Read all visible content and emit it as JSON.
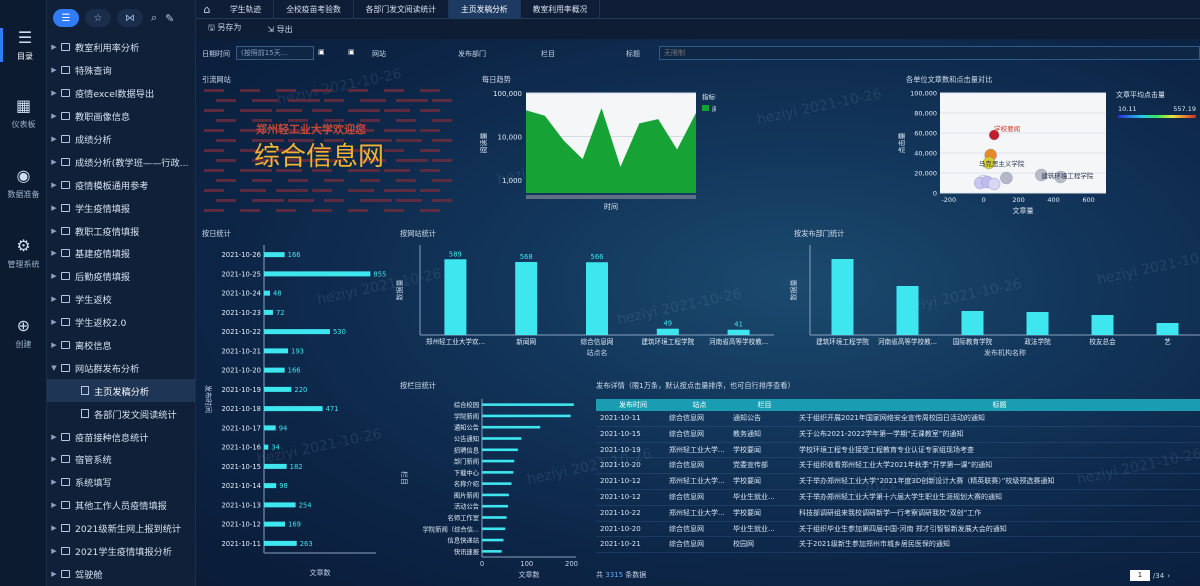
{
  "rail": [
    {
      "label": "目录",
      "icon": "list-icon"
    },
    {
      "label": "仪表板",
      "icon": "dashboard-icon"
    },
    {
      "label": "数据准备",
      "icon": "database-icon"
    },
    {
      "label": "管理系统",
      "icon": "gear-icon"
    },
    {
      "label": "创建",
      "icon": "plus-icon"
    }
  ],
  "tree": [
    {
      "label": "教室利用率分析",
      "child": false
    },
    {
      "label": "特殊查询",
      "child": false
    },
    {
      "label": "疫情excel数据导出",
      "child": false
    },
    {
      "label": "教职画像信息",
      "child": false
    },
    {
      "label": "成绩分析",
      "child": false
    },
    {
      "label": "成绩分析(教学班——行政...",
      "child": false
    },
    {
      "label": "疫情模板通用参考",
      "child": false
    },
    {
      "label": "学生疫情填报",
      "child": false
    },
    {
      "label": "教职工疫情填报",
      "child": false
    },
    {
      "label": "基建疫情填报",
      "child": false
    },
    {
      "label": "后勤疫情填报",
      "child": false
    },
    {
      "label": "学生返校",
      "child": false
    },
    {
      "label": "学生返校2.0",
      "child": false
    },
    {
      "label": "离校信息",
      "child": false
    },
    {
      "label": "网站群发布分析",
      "child": false,
      "open": true
    },
    {
      "label": "主页发稿分析",
      "child": true,
      "sel": true
    },
    {
      "label": "各部门发文阅读统计",
      "child": true
    },
    {
      "label": "疫苗接种信息统计",
      "child": false
    },
    {
      "label": "宿管系统",
      "child": false
    },
    {
      "label": "系统填写",
      "child": false
    },
    {
      "label": "其他工作人员疫情填报",
      "child": false
    },
    {
      "label": "2021级新生网上报到统计",
      "child": false
    },
    {
      "label": "2021学生疫情填报分析",
      "child": false
    },
    {
      "label": "驾驶舱",
      "child": false
    }
  ],
  "tabs": [
    "学生轨迹",
    "全校疫苗考验数",
    "各部门发文阅读统计",
    "主页发稿分析",
    "教室利用率概况"
  ],
  "active_tab": 3,
  "toolbar": {
    "save": "另存为",
    "export": "导出"
  },
  "filters": {
    "date_label": "日期时间",
    "date_value": "(按照前15天...",
    "site_label": "网站",
    "dept_label": "发布部门",
    "column_label": "栏目",
    "title_label": "标题",
    "title_placeholder": "无限制"
  },
  "wordcloud": {
    "title": "引流网站",
    "main": "综合信息网",
    "sub": "郑州轻工业大学欢迎您"
  },
  "trend": {
    "title": "每日趋势",
    "ylabel": "阅读量",
    "xlabel": "时间",
    "legend_title": "指标名称",
    "legend_item": "阅读量",
    "yticks": [
      "100,000",
      "10,000",
      "1,000"
    ]
  },
  "scatter": {
    "title": "各单位文章数和点击量对比",
    "xlabel": "文章量",
    "ylabel": "点击量",
    "colorbar_title": "文章平均点击量",
    "cb_min": "10.11",
    "cb_max": "557.19",
    "labels": [
      "学校要闻",
      "马克思主义学院",
      "建筑环境工程学院"
    ],
    "xticks": [
      "-200",
      "0",
      "200",
      "400",
      "600"
    ],
    "yticks": [
      "100,000",
      "80,000",
      "60,000",
      "40,000",
      "20,000",
      "0"
    ]
  },
  "colors": {
    "accent": "#2f7cf6",
    "bar": "#3ee6f0",
    "area": "#16a235",
    "header": "#1a9db2"
  },
  "chart_data": [
    {
      "type": "bar",
      "orientation": "horizontal",
      "title": "按日统计",
      "xlabel": "文章数",
      "ylabel": "发布时间",
      "categories": [
        "2021-10-26",
        "2021-10-25",
        "2021-10-24",
        "2021-10-23",
        "2021-10-22",
        "2021-10-21",
        "2021-10-20",
        "2021-10-19",
        "2021-10-18",
        "2021-10-17",
        "2021-10-16",
        "2021-10-15",
        "2021-10-14",
        "2021-10-13",
        "2021-10-12",
        "2021-10-11"
      ],
      "values": [
        166,
        855,
        48,
        72,
        530,
        193,
        166,
        220,
        471,
        94,
        34,
        182,
        98,
        254,
        169,
        263
      ],
      "xlim": [
        0,
        900
      ]
    },
    {
      "type": "bar",
      "title": "按网站统计",
      "xlabel": "站点名",
      "ylabel": "数据量",
      "categories": [
        "郑州轻工业大学欢...",
        "新闻网",
        "综合信息网",
        "建筑环境工程学院",
        "河南省高等学校教..."
      ],
      "values": [
        589,
        568,
        566,
        49,
        41
      ],
      "ylim": [
        0,
        700
      ]
    },
    {
      "type": "bar",
      "title": "按发布部门统计",
      "xlabel": "发布机构名称",
      "ylabel": "数据量",
      "categories": [
        "建筑环境工程学院",
        "河南省高等学校教...",
        "国际教育学院",
        "政法学院",
        "校友总会",
        "艺"
      ],
      "values": [
        380,
        245,
        120,
        115,
        100,
        60
      ],
      "ylim": [
        0,
        450
      ]
    },
    {
      "type": "bar",
      "orientation": "horizontal",
      "title": "按栏目统计",
      "xlabel": "文章数",
      "ylabel": "栏目",
      "categories": [
        "综合校园",
        "学院新闻",
        "通知公告",
        "公告通知",
        "招聘信息",
        "部门新闻",
        "下载中心",
        "名称介绍",
        "图片新闻",
        "活动公告",
        "名师工作室",
        "学院新闻（综合信...",
        "信息快递站",
        "快讯速报"
      ],
      "values": [
        205,
        198,
        130,
        88,
        80,
        72,
        70,
        66,
        60,
        58,
        55,
        52,
        48,
        44
      ],
      "xticks": [
        "0",
        "100",
        "200"
      ],
      "xlim": [
        0,
        210
      ]
    },
    {
      "type": "area",
      "title": "每日趋势",
      "series": [
        {
          "name": "阅读量",
          "values": [
            40000,
            30000,
            8000,
            3000,
            45000,
            2000,
            20000,
            25000,
            5000,
            35000
          ]
        }
      ],
      "ylog": true,
      "ylim": [
        500,
        100000
      ]
    },
    {
      "type": "scatter",
      "title": "各单位文章数和点击量对比",
      "points": [
        {
          "x": 60,
          "y": 58000,
          "label": "学校要闻"
        },
        {
          "x": 40,
          "y": 38000
        },
        {
          "x": 30,
          "y": 30000,
          "label": "马克思主义学院"
        },
        {
          "x": 0,
          "y": 12000
        },
        {
          "x": -20,
          "y": 10000
        },
        {
          "x": 20,
          "y": 11000
        },
        {
          "x": 60,
          "y": 9000
        },
        {
          "x": 130,
          "y": 15000
        },
        {
          "x": 330,
          "y": 18000,
          "label": "建筑环境工程学院"
        },
        {
          "x": 440,
          "y": 16000
        }
      ],
      "xlim": [
        -250,
        700
      ],
      "ylim": [
        0,
        100000
      ]
    }
  ],
  "table": {
    "title": "发布详情（限1万条，默认按点击量排序，也可自行排序查看）",
    "headers": [
      "发布时间",
      "站点",
      "栏目",
      "标题"
    ],
    "rows": [
      [
        "2021-10-11",
        "综合信息网",
        "通知公告",
        "关于组织开展2021年国家网络安全宣传周校园日活动的通知"
      ],
      [
        "2021-10-15",
        "综合信息网",
        "教务通知",
        "关于公布2021-2022学年第一学期“无课教室”的通知"
      ],
      [
        "2021-10-19",
        "郑州轻工业大学...",
        "学校要闻",
        "学校环境工程专业接受工程教育专业认证专家组现场考查"
      ],
      [
        "2021-10-20",
        "综合信息网",
        "党委宣传部",
        "关于组织收看郑州轻工业大学2021年秋季“开学第一课”的通知"
      ],
      [
        "2021-10-12",
        "郑州轻工业大学...",
        "学校要闻",
        "关于举办郑州轻工业大学“2021年度3D创新设计大赛（精英联赛）”校级预选赛通知"
      ],
      [
        "2021-10-12",
        "综合信息网",
        "毕业生就业...",
        "关于举办郑州轻工业大学第十六届大学生职业生涯规划大赛的通知"
      ],
      [
        "2021-10-22",
        "郑州轻工业大学...",
        "学校要闻",
        "科技部调研组来我校调研新学一行考察调研我校“双创”工作"
      ],
      [
        "2021-10-20",
        "综合信息网",
        "毕业生就业...",
        "关于组织毕业生参加第四届中国-河南 郑才引智智新发展大会的通知"
      ],
      [
        "2021-10-21",
        "综合信息网",
        "校园网",
        "关于2021级新生参加郑州市城乡居民医保的通知"
      ]
    ]
  },
  "footer": {
    "total_prefix": "共",
    "total": "3315",
    "total_suffix": "条数据",
    "page": "1",
    "pages": "/34"
  },
  "watermark": "heziyi 2021-10-26"
}
